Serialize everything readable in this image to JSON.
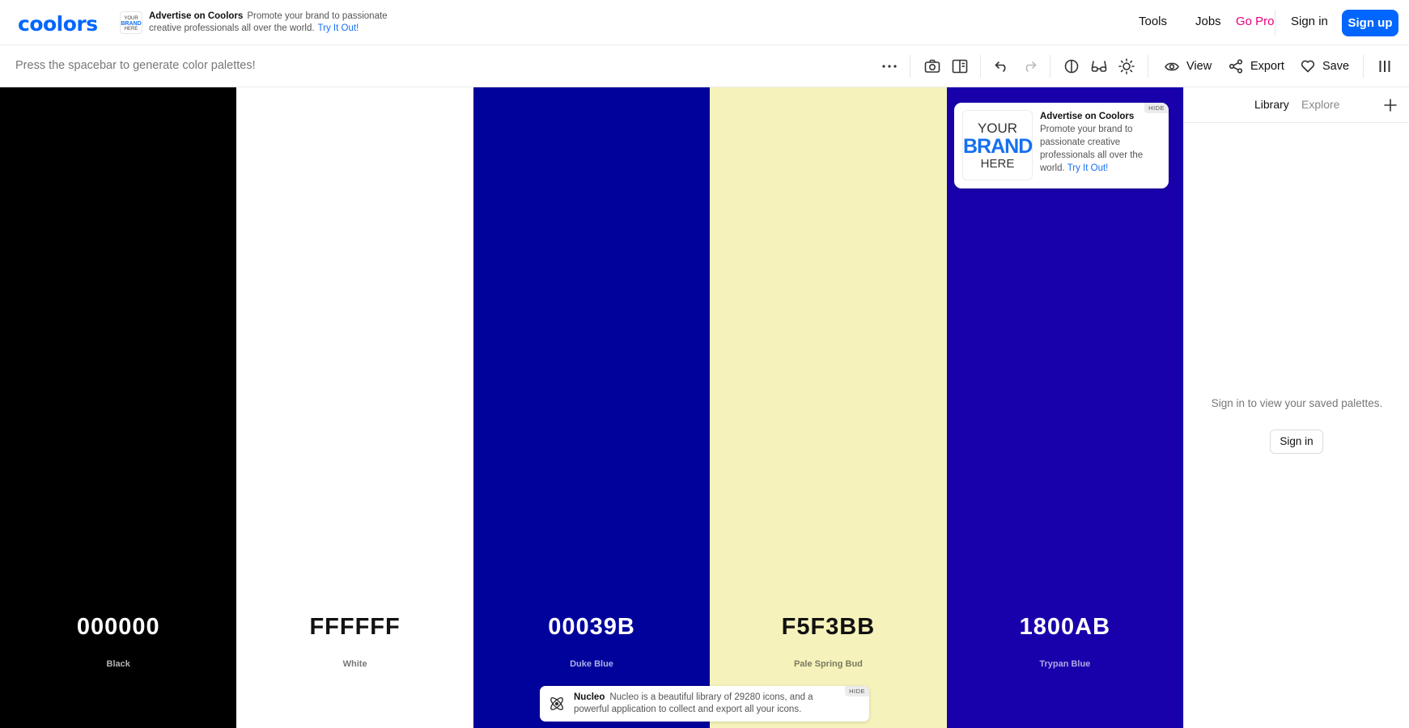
{
  "nav": {
    "logo": "coolors",
    "ad": {
      "thumb_line1": "YOUR",
      "thumb_line2": "BRAND",
      "thumb_line3": "HERE",
      "title": "Advertise on Coolors",
      "text": "Promote your brand to passionate creative professionals all over the world.",
      "link": "Try It Out!"
    },
    "links": {
      "tools": "Tools",
      "jobs": "Jobs",
      "gopro": "Go Pro",
      "signin": "Sign in",
      "signup": "Sign up"
    },
    "gopro_color": "#e6007e",
    "accent": "#0066ff"
  },
  "toolbar": {
    "hint": "Press the spacebar to generate color palettes!",
    "icons": [
      "more-icon",
      "camera-icon",
      "sidebar-layout-icon",
      "undo-icon",
      "redo-icon",
      "contrast-icon",
      "glasses-icon",
      "brightness-icon"
    ],
    "view_label": "View",
    "export_label": "Export",
    "save_label": "Save"
  },
  "palette": [
    {
      "hex": "000000",
      "name": "Black",
      "bg": "#000000",
      "fg": "#ffffff",
      "name_color": "#b3b3b3"
    },
    {
      "hex": "FFFFFF",
      "name": "White",
      "bg": "#ffffff",
      "fg": "#111111",
      "name_color": "#777777"
    },
    {
      "hex": "00039B",
      "name": "Duke Blue",
      "bg": "#00039b",
      "fg": "#ffffff",
      "name_color": "#aab0e6"
    },
    {
      "hex": "F5F3BB",
      "name": "Pale Spring Bud",
      "bg": "#f5f3bb",
      "fg": "#111111",
      "name_color": "#7a7960"
    },
    {
      "hex": "1800AB",
      "name": "Trypan Blue",
      "bg": "#1800ab",
      "fg": "#ffffff",
      "name_color": "#b0a8e8"
    }
  ],
  "ad_card": {
    "hide": "HIDE",
    "thumb_line1": "YOUR",
    "thumb_line2": "BRAND",
    "thumb_line3": "HERE",
    "title": "Advertise on Coolors",
    "text": "Promote your brand to passionate creative professionals all over the world.",
    "link": "Try It Out!"
  },
  "ad_bottom": {
    "hide": "HIDE",
    "title": "Nucleo",
    "text": "Nucleo is a beautiful library of 29280 icons, and a powerful application to collect and export all your icons."
  },
  "sidepanel": {
    "tab_library": "Library",
    "tab_explore": "Explore",
    "message": "Sign in to view your saved palettes.",
    "signin": "Sign in"
  }
}
